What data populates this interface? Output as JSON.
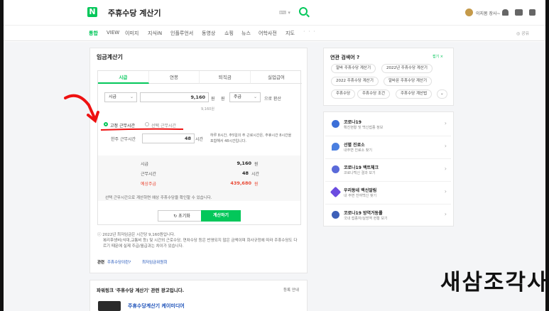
{
  "header": {
    "logo": "N",
    "query": "주휴수당 계산기",
    "keyboard_label": "⌨ ▾",
    "username": "이지봄 장사~"
  },
  "nav_tabs": [
    "통합",
    "VIEW",
    "이미지",
    "지식iN",
    "인플루언서",
    "동영상",
    "쇼핑",
    "뉴스",
    "어학사전",
    "지도"
  ],
  "nav_more": "· · ·",
  "nav_setting": "◎ 공유",
  "calc": {
    "title": "임금계산기",
    "tabs": [
      "시급",
      "연봉",
      "퇴직금",
      "실업급여"
    ],
    "unit_select": "시급",
    "wage_value": "9,160",
    "wage_unit": "원",
    "period_select": "주급",
    "suffix": "으로 환산",
    "hint": "9,160원",
    "radio_fixed": "고정 근무시간",
    "radio_select": "선택 근무시간",
    "week_label": "한주 근무시간",
    "week_value": "48",
    "week_unit": "시간",
    "week_note": "하루 8시간, 주5일의 주 근로시간은, 주휴시간 8시간을 포함해서 48시간입니다.",
    "results": [
      {
        "label": "시급",
        "value": "9,160",
        "unit": "원"
      },
      {
        "label": "근무시간",
        "value": "48",
        "unit": "시간"
      },
      {
        "label": "예상주급",
        "value": "439,680",
        "unit": "원"
      }
    ],
    "notice": "선택 근무시간으로 계산하면 예상 주휴수당을 확인할 수 있습니다.",
    "reset": "↻ 초기화",
    "submit": "계산하기",
    "footnote1": "2022년 최저임금은 시간당 9,160원입니다.",
    "footnote2": "복리후생비(식대,교통비 등) 및 시간외 근로수당, 연차수당 등은 반영되지 않은 금액이며 회사규정에 따라 주휴수당도 다르기 때문에 실제 주급/월급과는 차이가 있습니다.",
    "related_label": "관련",
    "related1": "주휴수당이란?",
    "related2": "최저임금위원회"
  },
  "related_search": {
    "title": "연관 검색어 ?",
    "close": "접기 ×",
    "keywords": [
      "알바 주휴수당 계산기",
      "2022년 주휴수당 계산기",
      "2022 주휴수당 계산기",
      "알바몬 주휴수당 계산기",
      "주휴수당",
      "주휴수당 조건",
      "주휴수당 계산법"
    ],
    "expand": "⌄"
  },
  "covid": [
    {
      "title": "코로나19",
      "sub": "확진현황 및 백신접종 정보",
      "color": "#3c6fd8"
    },
    {
      "title": "선별 진료소",
      "sub": "내주변 진료소 찾기",
      "color": "#4a7fe0"
    },
    {
      "title": "코로나19 백트체크",
      "sub": "코로나백신 결과 보기",
      "color": "#5a6ad9"
    },
    {
      "title": "우리동네 백신알림",
      "sub": "내 주변 잔여백신 찾기",
      "color": "#6b4ce0"
    },
    {
      "title": "코로나19 방역거동률",
      "sub": "국내 접종자/실방역 현황 보기",
      "color": "#3d5fb8"
    }
  ],
  "ad": {
    "title": "파워링크 '주휴수당 계산기' 관련 광고입니다.",
    "note": "등록 안내",
    "item": "주휴수당계산기 케이미디어"
  },
  "watermark": "새삼조각사",
  "colors": {
    "brand": "#03c75a",
    "accent_red": "#e94a36"
  }
}
